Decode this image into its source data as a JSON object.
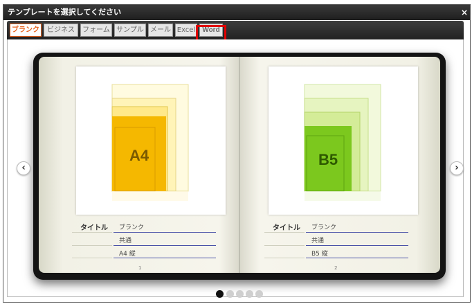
{
  "dialog": {
    "title": "テンプレートを選択してください",
    "close": "×"
  },
  "tabs": [
    "ブランク",
    "ビジネス",
    "フォーム",
    "サンプル",
    "メール",
    "Excel",
    "Word"
  ],
  "active_tab": "ブランク",
  "highlighted_tab": "Word",
  "nav": {
    "prev": "‹",
    "next": "›"
  },
  "templates": [
    {
      "size": "A4",
      "color": "#f5b800",
      "title_label": "タイトル",
      "title": "ブランク",
      "type": "共通",
      "format": "A4 縦",
      "page": "1"
    },
    {
      "size": "B5",
      "color": "#7cc81e",
      "title_label": "タイトル",
      "title": "ブランク",
      "type": "共通",
      "format": "B5 縦",
      "page": "2"
    }
  ],
  "pagination": {
    "total": 5,
    "current": 1
  }
}
